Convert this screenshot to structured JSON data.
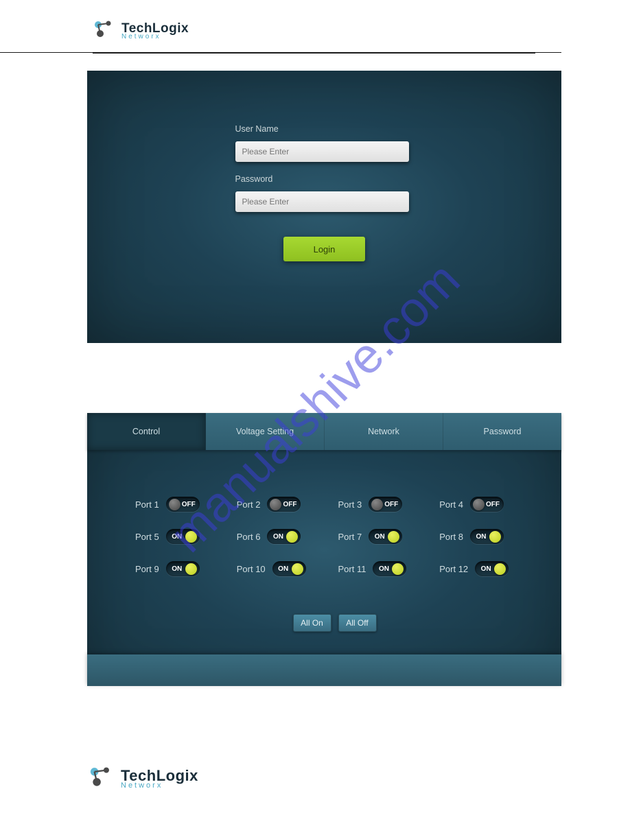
{
  "brand": {
    "name": "TechLogix",
    "sub": "Networx"
  },
  "watermark": "manualshive.com",
  "login": {
    "username_label": "User Name",
    "username_placeholder": "Please Enter",
    "password_label": "Password",
    "password_placeholder": "Please Enter",
    "button": "Login"
  },
  "tabs": {
    "control": "Control",
    "voltage": "Voltage Setting",
    "network": "Network",
    "password": "Password"
  },
  "ports": [
    {
      "label": "Port 1",
      "state": "OFF"
    },
    {
      "label": "Port 2",
      "state": "OFF"
    },
    {
      "label": "Port 3",
      "state": "OFF"
    },
    {
      "label": "Port 4",
      "state": "OFF"
    },
    {
      "label": "Port 5",
      "state": "ON"
    },
    {
      "label": "Port 6",
      "state": "ON"
    },
    {
      "label": "Port 7",
      "state": "ON"
    },
    {
      "label": "Port 8",
      "state": "ON"
    },
    {
      "label": "Port 9",
      "state": "ON"
    },
    {
      "label": "Port 10",
      "state": "ON"
    },
    {
      "label": "Port 11",
      "state": "ON"
    },
    {
      "label": "Port 12",
      "state": "ON"
    }
  ],
  "bulk": {
    "all_on": "All On",
    "all_off": "All Off"
  }
}
